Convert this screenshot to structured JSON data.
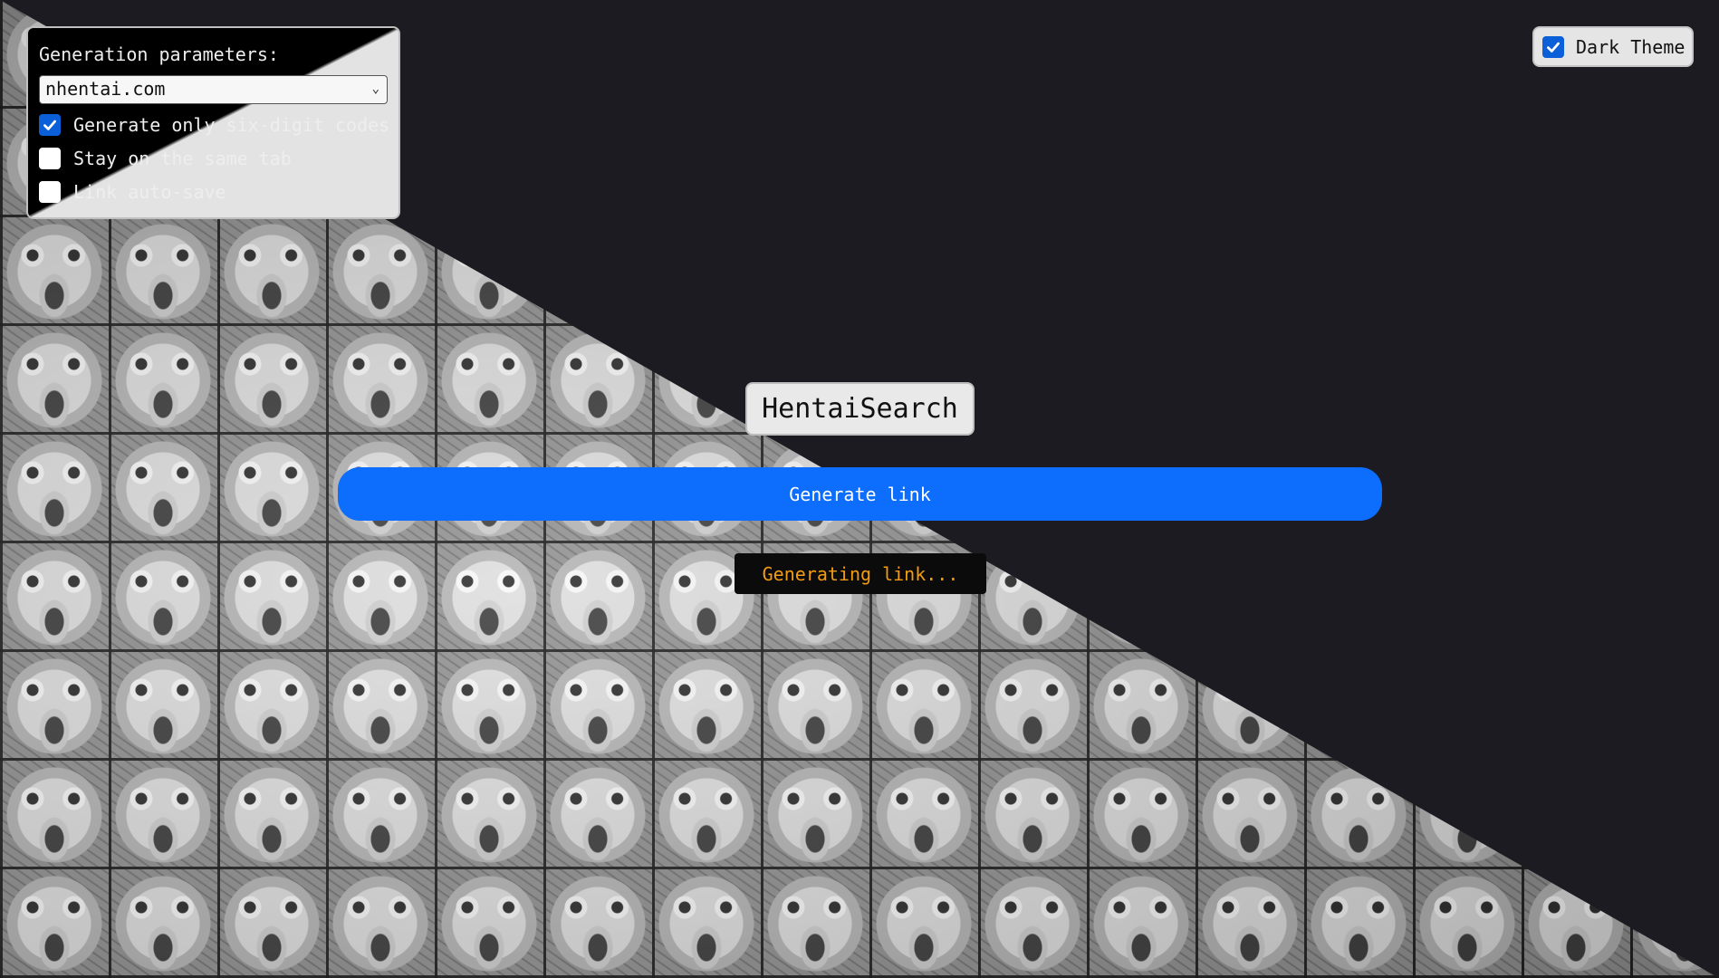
{
  "settings": {
    "title": "Generation parameters:",
    "site_select": {
      "selected": "nhentai.com"
    },
    "options": [
      {
        "label": "Generate only six-digit codes",
        "checked": true
      },
      {
        "label": "Stay on the same tab",
        "checked": false
      },
      {
        "label": "Link auto-save",
        "checked": false
      }
    ]
  },
  "theme": {
    "label": "Dark Theme",
    "checked": true
  },
  "main": {
    "title": "HentaiSearch",
    "generate_label": "Generate link",
    "status_text": "Generating link..."
  },
  "colors": {
    "accent": "#0d6efd",
    "checkbox": "#0b5fd8",
    "status_text": "#f39c12",
    "background": "#1c1b21"
  }
}
